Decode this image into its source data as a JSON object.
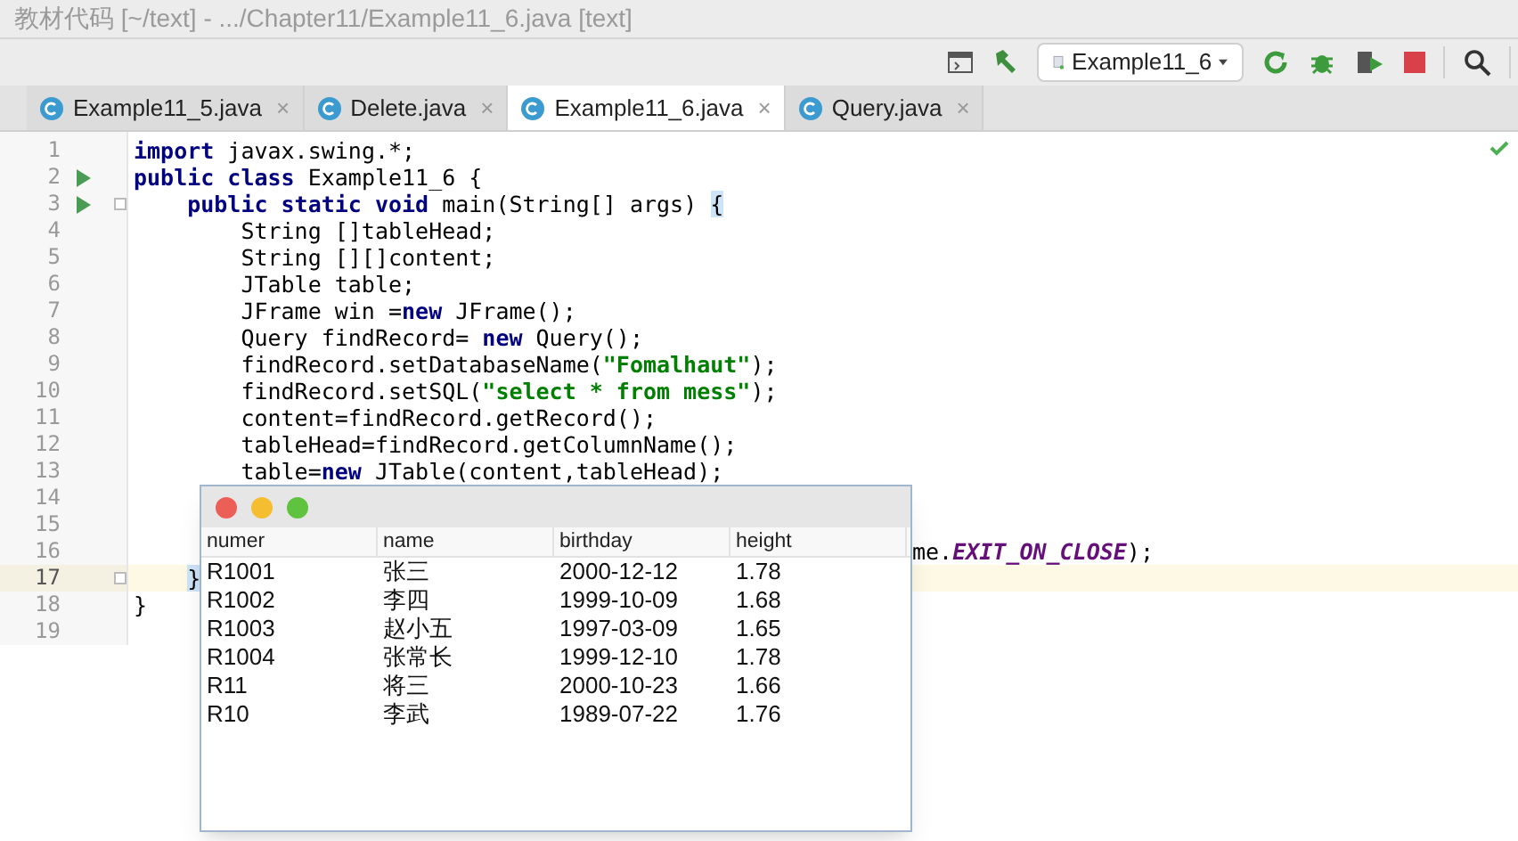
{
  "window": {
    "title": "教材代码 [~/text] - .../Chapter11/Example11_6.java [text]"
  },
  "toolbar": {
    "run_config": "Example11_6"
  },
  "tabs": [
    {
      "label": "Example11_5.java",
      "close": "×",
      "selected": false
    },
    {
      "label": "Delete.java",
      "close": "×",
      "selected": false
    },
    {
      "label": "Example11_6.java",
      "close": "×",
      "selected": true
    },
    {
      "label": "Query.java",
      "close": "×",
      "selected": false
    }
  ],
  "editor": {
    "lines": [
      {
        "number": "1",
        "run": false,
        "fold": false,
        "current": false,
        "kind": "full",
        "tokens": [
          {
            "kind": "keyword",
            "text": "import"
          },
          {
            "kind": "plain",
            "text": " javax.swing.*;"
          }
        ]
      },
      {
        "number": "2",
        "run": true,
        "fold": false,
        "current": false,
        "kind": "full",
        "tokens": [
          {
            "kind": "keyword",
            "text": "public class"
          },
          {
            "kind": "plain",
            "text": " Example11_6 {"
          }
        ]
      },
      {
        "number": "3",
        "run": true,
        "fold": true,
        "current": false,
        "kind": "full",
        "tokens": [
          {
            "kind": "keyword",
            "text": "    public static void"
          },
          {
            "kind": "plain",
            "text": " main(String[] args) "
          },
          {
            "kind": "brace",
            "text": "{"
          }
        ]
      },
      {
        "number": "4",
        "run": false,
        "fold": false,
        "current": false,
        "kind": "full",
        "tokens": [
          {
            "kind": "plain",
            "text": "        String []tableHead;"
          }
        ]
      },
      {
        "number": "5",
        "run": false,
        "fold": false,
        "current": false,
        "kind": "full",
        "tokens": [
          {
            "kind": "plain",
            "text": "        String [][]content;"
          }
        ]
      },
      {
        "number": "6",
        "run": false,
        "fold": false,
        "current": false,
        "kind": "full",
        "tokens": [
          {
            "kind": "plain",
            "text": "        JTable table;"
          }
        ]
      },
      {
        "number": "7",
        "run": false,
        "fold": false,
        "current": false,
        "kind": "full",
        "tokens": [
          {
            "kind": "plain",
            "text": "        JFrame win ="
          },
          {
            "kind": "keyword",
            "text": "new"
          },
          {
            "kind": "plain",
            "text": " JFrame();"
          }
        ]
      },
      {
        "number": "8",
        "run": false,
        "fold": false,
        "current": false,
        "kind": "full",
        "tokens": [
          {
            "kind": "plain",
            "text": "        Query findRecord= "
          },
          {
            "kind": "keyword",
            "text": "new"
          },
          {
            "kind": "plain",
            "text": " Query();"
          }
        ]
      },
      {
        "number": "9",
        "run": false,
        "fold": false,
        "current": false,
        "kind": "full",
        "tokens": [
          {
            "kind": "plain",
            "text": "        findRecord.setDatabaseName("
          },
          {
            "kind": "string",
            "text": "\"Fomalhaut\""
          },
          {
            "kind": "plain",
            "text": ");"
          }
        ]
      },
      {
        "number": "10",
        "run": false,
        "fold": false,
        "current": false,
        "kind": "full",
        "tokens": [
          {
            "kind": "plain",
            "text": "        findRecord.setSQL("
          },
          {
            "kind": "string",
            "text": "\"select * from mess\""
          },
          {
            "kind": "plain",
            "text": ");"
          }
        ]
      },
      {
        "number": "11",
        "run": false,
        "fold": false,
        "current": false,
        "kind": "full",
        "tokens": [
          {
            "kind": "plain",
            "text": "        content=findRecord.getRecord();"
          }
        ]
      },
      {
        "number": "12",
        "run": false,
        "fold": false,
        "current": false,
        "kind": "full",
        "tokens": [
          {
            "kind": "plain",
            "text": "        tableHead=findRecord.getColumnName();"
          }
        ]
      },
      {
        "number": "13",
        "run": false,
        "fold": false,
        "current": false,
        "kind": "full",
        "tokens": [
          {
            "kind": "plain",
            "text": "        table="
          },
          {
            "kind": "keyword",
            "text": "new"
          },
          {
            "kind": "plain",
            "text": " JTable(content,tableHead);"
          }
        ]
      },
      {
        "number": "14",
        "run": false,
        "fold": false,
        "current": false
      },
      {
        "number": "15",
        "run": false,
        "fold": false,
        "current": false
      },
      {
        "number": "16",
        "run": false,
        "fold": false,
        "current": false,
        "kind": "tail",
        "tokens": [
          {
            "kind": "plain",
            "text": "me."
          },
          {
            "kind": "constant",
            "text": "EXIT_ON_CLOSE"
          },
          {
            "kind": "plain",
            "text": ");"
          }
        ]
      },
      {
        "number": "17",
        "run": false,
        "fold": true,
        "current": true,
        "kind": "full",
        "tokens": [
          {
            "kind": "brace",
            "text": "    }"
          }
        ]
      },
      {
        "number": "18",
        "run": false,
        "fold": false,
        "current": false,
        "kind": "full",
        "tokens": [
          {
            "kind": "plain",
            "text": "}"
          }
        ]
      },
      {
        "number": "19",
        "run": false,
        "fold": false,
        "current": false
      }
    ]
  },
  "table_window": {
    "columns": [
      "numer",
      "name",
      "birthday",
      "height"
    ],
    "rows": [
      [
        "R1001",
        "张三",
        "2000-12-12",
        "1.78"
      ],
      [
        "R1002",
        "李四",
        "1999-10-09",
        "1.68"
      ],
      [
        "R1003",
        "赵小五",
        "1997-03-09",
        "1.65"
      ],
      [
        "R1004",
        "张常长",
        "1999-12-10",
        "1.78"
      ],
      [
        "R11",
        "将三",
        "2000-10-23",
        "1.66"
      ],
      [
        "R10",
        "李武",
        "1989-07-22",
        "1.76"
      ]
    ]
  }
}
